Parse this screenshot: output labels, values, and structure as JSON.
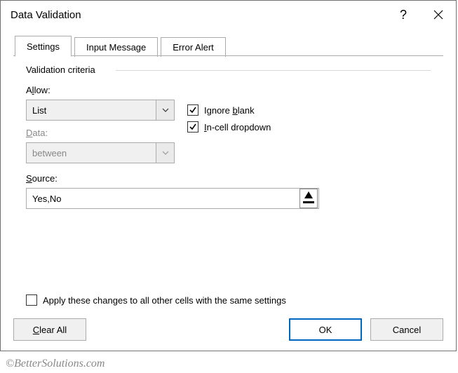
{
  "title": "Data Validation",
  "tabs": {
    "settings": "Settings",
    "input_message": "Input Message",
    "error_alert": "Error Alert"
  },
  "group_title": "Validation criteria",
  "allow": {
    "label_pre": "A",
    "label_u": "l",
    "label_post": "low:",
    "value": "List"
  },
  "data_field": {
    "label_pre": "",
    "label_u": "D",
    "label_post": "ata:",
    "value": "between"
  },
  "source": {
    "label_pre": "",
    "label_u": "S",
    "label_post": "ource:",
    "value": "Yes,No"
  },
  "ignore_blank": {
    "pre": "Ignore ",
    "u": "b",
    "post": "lank"
  },
  "incell_dropdown": {
    "pre": "",
    "u": "I",
    "post": "n-cell dropdown"
  },
  "apply_changes": {
    "pre": "Apply these changes to all other cells with the same settings",
    "u": "",
    "post": ""
  },
  "buttons": {
    "clear_all_pre": "",
    "clear_all_u": "C",
    "clear_all_post": "lear All",
    "ok": "OK",
    "cancel": "Cancel"
  },
  "watermark": "©BetterSolutions.com"
}
